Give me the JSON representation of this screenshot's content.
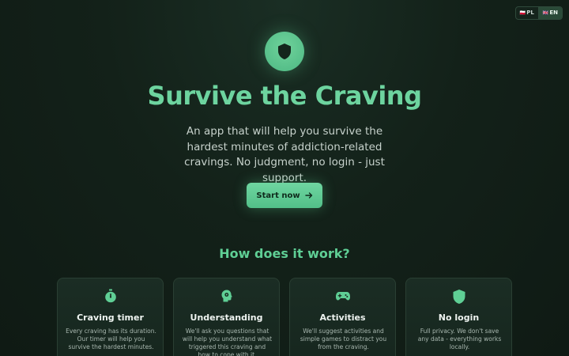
{
  "lang": {
    "options": [
      {
        "flag": "🇵🇱",
        "code": "PL"
      },
      {
        "flag": "🇬🇧",
        "code": "EN"
      }
    ]
  },
  "hero": {
    "icon": "shield-icon",
    "title": "Survive the Craving",
    "subtitle": "An app that will help you survive the hardest minutes of addiction-related cravings. No judgment, no login - just support.",
    "cta_label": "Start now"
  },
  "how": {
    "title": "How does it work?",
    "cards": [
      {
        "icon": "stopwatch-icon",
        "title": "Craving timer",
        "desc": "Every craving has its duration. Our timer will help you survive the hardest minutes."
      },
      {
        "icon": "head-gear-icon",
        "title": "Understanding",
        "desc": "We'll ask you questions that will help you understand what triggered this craving and how to cope with it."
      },
      {
        "icon": "gamepad-icon",
        "title": "Activities",
        "desc": "We'll suggest activities and simple games to distract you from the craving."
      },
      {
        "icon": "shield-icon",
        "title": "No login",
        "desc": "Full privacy. We don't save any data - everything works locally."
      }
    ]
  },
  "colors": {
    "accent": "#6dd49f",
    "background": "#132119"
  }
}
